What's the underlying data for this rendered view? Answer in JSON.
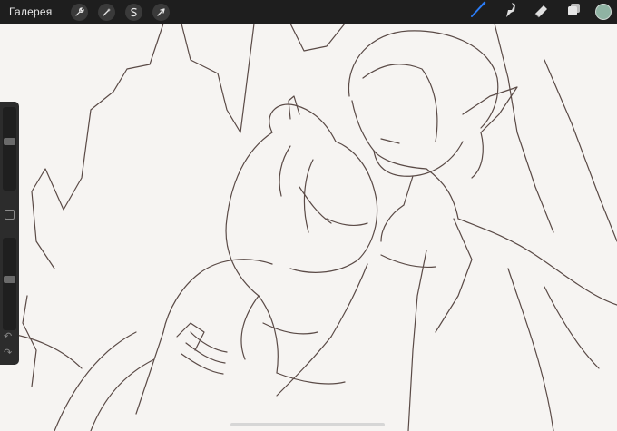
{
  "toolbar": {
    "gallery_label": "Галерея",
    "left_tools": [
      {
        "icon": "wrench-icon",
        "name": "actions-button"
      },
      {
        "icon": "magic-wand-icon",
        "name": "adjustments-button"
      },
      {
        "icon": "selection-s-icon",
        "name": "selection-button"
      },
      {
        "icon": "arrow-cursor-icon",
        "name": "transform-button"
      }
    ],
    "right_tools": [
      {
        "icon": "brush-icon",
        "name": "brush-tool",
        "active": true
      },
      {
        "icon": "smudge-icon",
        "name": "smudge-tool"
      },
      {
        "icon": "eraser-icon",
        "name": "eraser-tool"
      },
      {
        "icon": "layers-icon",
        "name": "layers-button"
      }
    ],
    "current_color": "#8fb3a3",
    "active_tool_color": "#2b7cf6"
  },
  "sidebar": {
    "brush_size_level": 0.6,
    "opacity_level": 0.55,
    "modify_icon": "square-icon",
    "undo_icon": "undo-arrow-icon",
    "redo_icon": "redo-arrow-icon"
  },
  "canvas": {
    "content": "line-art-sketch",
    "line_color": "#5a4a46"
  }
}
